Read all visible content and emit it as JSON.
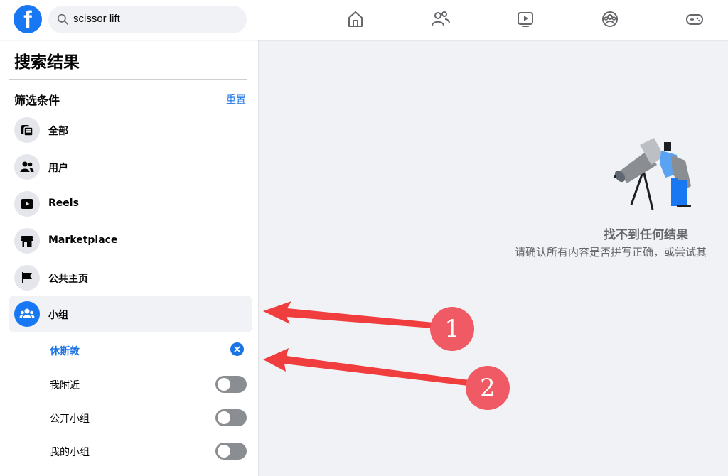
{
  "app": {
    "logo_letter": "f"
  },
  "search": {
    "value": "scissor lift"
  },
  "nav": [
    {
      "name": "home-icon"
    },
    {
      "name": "friends-icon"
    },
    {
      "name": "watch-icon"
    },
    {
      "name": "groups-icon"
    },
    {
      "name": "gaming-icon"
    }
  ],
  "sidebar": {
    "title": "搜索结果",
    "filters_label": "筛选条件",
    "reset_label": "重置",
    "items": [
      {
        "label": "全部",
        "icon": "all-results-icon"
      },
      {
        "label": "用户",
        "icon": "people-icon"
      },
      {
        "label": "Reels",
        "icon": "reels-icon"
      },
      {
        "label": "Marketplace",
        "icon": "marketplace-icon"
      },
      {
        "label": "公共主页",
        "icon": "pages-flag-icon"
      },
      {
        "label": "小组",
        "icon": "groups-icon",
        "active": true
      }
    ],
    "group_filters": {
      "location": "休斯敦",
      "toggles": [
        {
          "label": "我附近",
          "on": false
        },
        {
          "label": "公开小组",
          "on": false
        },
        {
          "label": "我的小组",
          "on": false
        }
      ]
    }
  },
  "main": {
    "empty_title": "找不到任何结果",
    "empty_subtitle": "请确认所有内容是否拼写正确，或尝试其"
  },
  "annotations": [
    {
      "label": "1"
    },
    {
      "label": "2"
    }
  ],
  "colors": {
    "brand": "#1877f2",
    "link": "#1b74e4",
    "annotation": "#f05a64",
    "background": "#f0f2f5"
  }
}
